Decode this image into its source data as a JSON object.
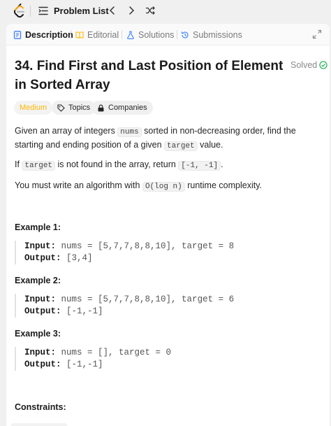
{
  "topbar": {
    "problem_list_label": "Problem List",
    "icons": [
      "leetcode-logo",
      "list-icon",
      "chevron-left-icon",
      "chevron-right-icon",
      "shuffle-icon"
    ]
  },
  "tabs": [
    {
      "label": "Description",
      "active": true,
      "icon": "description-icon"
    },
    {
      "label": "Editorial",
      "active": false,
      "icon": "book-icon"
    },
    {
      "label": "Solutions",
      "active": false,
      "icon": "flask-icon"
    },
    {
      "label": "Submissions",
      "active": false,
      "icon": "history-icon"
    }
  ],
  "problem": {
    "title": "34. Find First and Last Position of Element in Sorted Array",
    "status": "Solved",
    "difficulty": "Medium",
    "topics_label": "Topics",
    "companies_label": "Companies",
    "desc1_a": "Given an array of integers ",
    "desc1_code1": "nums",
    "desc1_b": " sorted in non-decreasing order, find the starting and ending position of a given ",
    "desc1_code2": "target",
    "desc1_c": " value.",
    "desc2_a": "If ",
    "desc2_code1": "target",
    "desc2_b": " is not found in the array, return ",
    "desc2_code2": "[-1, -1]",
    "desc2_c": ".",
    "desc3_a": "You must write an algorithm with ",
    "desc3_code": "O(log n)",
    "desc3_b": " runtime complexity."
  },
  "examples": [
    {
      "heading": "Example 1:",
      "input_label": "Input:",
      "input": "nums = [5,7,7,8,8,10], target = 8",
      "output_label": "Output:",
      "output": "[3,4]"
    },
    {
      "heading": "Example 2:",
      "input_label": "Input:",
      "input": "nums = [5,7,7,8,8,10], target = 6",
      "output_label": "Output:",
      "output": "[-1,-1]"
    },
    {
      "heading": "Example 3:",
      "input_label": "Input:",
      "input": "nums = [], target = 0",
      "output_label": "Output:",
      "output": "[-1,-1]"
    }
  ],
  "constraints_heading": "Constraints:",
  "colors": {
    "accent_orange": "#ffb800",
    "solved_green": "#2db55d"
  }
}
